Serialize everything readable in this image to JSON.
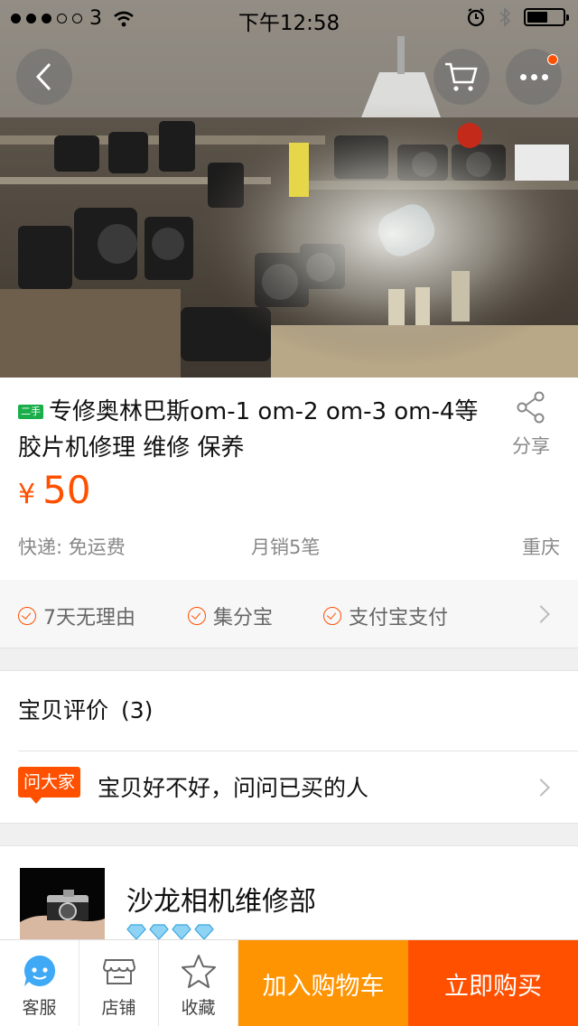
{
  "status_bar": {
    "carrier": "3",
    "time": "下午12:58"
  },
  "hero": {
    "icons": [
      "back-icon",
      "cart-icon",
      "more-icon"
    ],
    "badge_color": "#ff5000"
  },
  "product": {
    "badge": "二手",
    "title": "专修奥林巴斯om-1 om-2 om-3 om-4等胶片机修理 维修 保养",
    "share_label": "分享",
    "price_currency": "¥",
    "price": "50",
    "shipping": "快递: 免运费",
    "monthly_sales": "月销5笔",
    "location": "重庆"
  },
  "services": [
    {
      "label": "7天无理由"
    },
    {
      "label": "集分宝"
    },
    {
      "label": "支付宝支付"
    }
  ],
  "reviews": {
    "title": "宝贝评价",
    "count": "(3)",
    "ask_badge": "问大家",
    "ask_text": "宝贝好不好，问问已买的人"
  },
  "shop": {
    "name": "沙龙相机维修部",
    "diamond_count": 4
  },
  "bottom_bar": {
    "service_label": "客服",
    "store_label": "店铺",
    "favorite_label": "收藏",
    "add_to_cart_label": "加入购物车",
    "buy_now_label": "立即购买"
  },
  "colors": {
    "accent": "#ff5000",
    "cart_button": "#ff9402",
    "used_badge": "#1aae4a"
  }
}
